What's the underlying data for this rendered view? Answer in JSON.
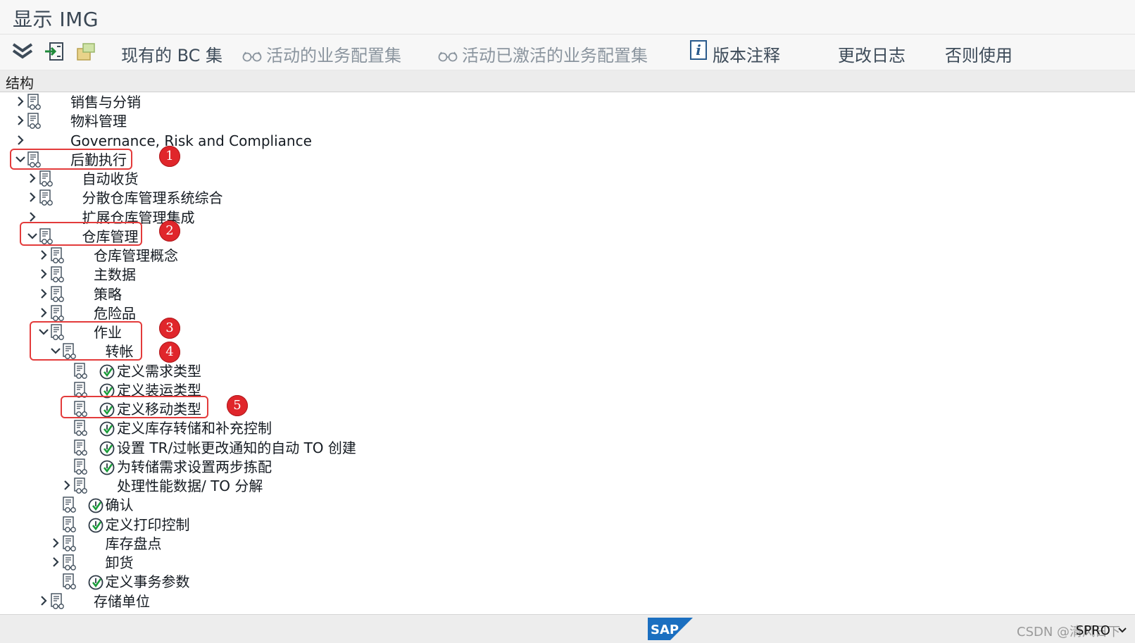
{
  "window": {
    "title": "显示 IMG"
  },
  "toolbar": {
    "existing_bc_sets": "现有的 BC 集",
    "active_biz_config_sets": "活动的业务配置集",
    "activated_biz_config_sets": "活动已激活的业务配置集",
    "release_notes": "版本注释",
    "change_log": "更改日志",
    "otherwise_use": "否则使用"
  },
  "structure": {
    "header": "结构"
  },
  "tree": [
    {
      "label": "销售与分销",
      "level": 0,
      "expander": "collapsed",
      "doc": true,
      "exec": false
    },
    {
      "label": "物料管理",
      "level": 0,
      "expander": "collapsed",
      "doc": true,
      "exec": false
    },
    {
      "label": "Governance, Risk and Compliance",
      "level": 0,
      "expander": "collapsed",
      "doc": false,
      "exec": false
    },
    {
      "label": "后勤执行",
      "level": 0,
      "expander": "expanded",
      "doc": true,
      "exec": false
    },
    {
      "label": "自动收货",
      "level": 1,
      "expander": "collapsed",
      "doc": true,
      "exec": false
    },
    {
      "label": "分散仓库管理系统综合",
      "level": 1,
      "expander": "collapsed",
      "doc": true,
      "exec": false
    },
    {
      "label": "扩展仓库管理集成",
      "level": 1,
      "expander": "collapsed",
      "doc": false,
      "exec": false
    },
    {
      "label": "仓库管理",
      "level": 1,
      "expander": "expanded",
      "doc": true,
      "exec": false
    },
    {
      "label": "仓库管理概念",
      "level": 2,
      "expander": "collapsed",
      "doc": true,
      "exec": false
    },
    {
      "label": "主数据",
      "level": 2,
      "expander": "collapsed",
      "doc": true,
      "exec": false
    },
    {
      "label": "策略",
      "level": 2,
      "expander": "collapsed",
      "doc": true,
      "exec": false
    },
    {
      "label": "危险品",
      "level": 2,
      "expander": "collapsed",
      "doc": true,
      "exec": false
    },
    {
      "label": "作业",
      "level": 2,
      "expander": "expanded",
      "doc": true,
      "exec": false
    },
    {
      "label": "转帐",
      "level": 3,
      "expander": "expanded",
      "doc": true,
      "exec": false
    },
    {
      "label": "定义需求类型",
      "level": 4,
      "expander": "leaf",
      "doc": true,
      "exec": true
    },
    {
      "label": "定义装运类型",
      "level": 4,
      "expander": "leaf",
      "doc": true,
      "exec": true
    },
    {
      "label": "定义移动类型",
      "level": 4,
      "expander": "leaf",
      "doc": true,
      "exec": true
    },
    {
      "label": "定义库存转储和补充控制",
      "level": 4,
      "expander": "leaf",
      "doc": true,
      "exec": true
    },
    {
      "label": "设置 TR/过帐更改通知的自动 TO 创建",
      "level": 4,
      "expander": "leaf",
      "doc": true,
      "exec": true
    },
    {
      "label": "为转储需求设置两步拣配",
      "level": 4,
      "expander": "leaf",
      "doc": true,
      "exec": true
    },
    {
      "label": "处理性能数据/ TO 分解",
      "level": 4,
      "expander": "collapsed",
      "doc": true,
      "exec": false
    },
    {
      "label": "确认",
      "level": 3,
      "expander": "leaf",
      "doc": true,
      "exec": true
    },
    {
      "label": "定义打印控制",
      "level": 3,
      "expander": "leaf",
      "doc": true,
      "exec": true
    },
    {
      "label": "库存盘点",
      "level": 3,
      "expander": "collapsed",
      "doc": true,
      "exec": false
    },
    {
      "label": "卸货",
      "level": 3,
      "expander": "collapsed",
      "doc": true,
      "exec": false
    },
    {
      "label": "定义事务参数",
      "level": 3,
      "expander": "leaf",
      "doc": true,
      "exec": true
    },
    {
      "label": "存储单位",
      "level": 2,
      "expander": "collapsed",
      "doc": true,
      "exec": false
    }
  ],
  "annotations": [
    "1",
    "2",
    "3",
    "4",
    "5"
  ],
  "status": {
    "logo": "SAP",
    "watermark": "CSDN @清风日下",
    "transaction": "SPRO"
  },
  "colors": {
    "highlight": "#e33b3b",
    "badge": "#e0262b",
    "exec_icon": "#1a9c3a",
    "sap_blue": "#1b6fc0"
  }
}
